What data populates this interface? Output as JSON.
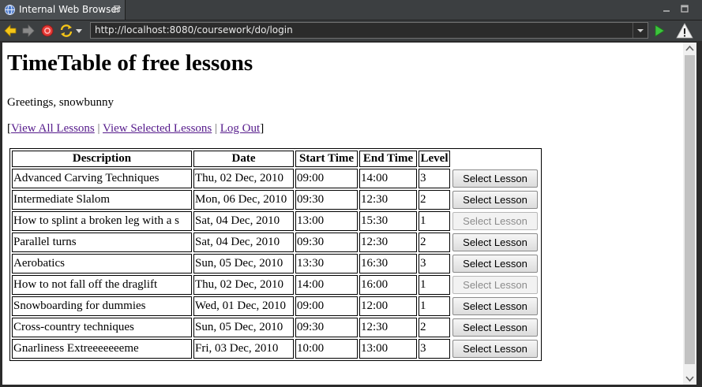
{
  "window": {
    "tab_title": "Internal Web Browser",
    "close_glyph": "⊠"
  },
  "toolbar": {
    "url": "http://localhost:8080/coursework/do/login",
    "icons": [
      "back-icon",
      "forward-icon",
      "stop-icon",
      "refresh-icon",
      "go-icon",
      "warning-icon"
    ]
  },
  "page": {
    "title": "TimeTable of free lessons",
    "greeting": "Greetings, snowbunny",
    "nav": {
      "open_bracket": "[",
      "close_bracket": "]",
      "separator": "|",
      "view_all": "View All Lessons",
      "view_selected": "View Selected Lessons",
      "logout": "Log Out"
    },
    "table": {
      "headers": [
        "Description",
        "Date",
        "Start Time",
        "End Time",
        "Level"
      ],
      "button_label": "Select Lesson",
      "rows": [
        {
          "desc": "Advanced Carving Techniques",
          "date": "Thu, 02 Dec, 2010",
          "start": "09:00",
          "end": "14:00",
          "level": "3",
          "enabled": true
        },
        {
          "desc": "Intermediate Slalom",
          "date": "Mon, 06 Dec, 2010",
          "start": "09:30",
          "end": "12:30",
          "level": "2",
          "enabled": true
        },
        {
          "desc": "How to splint a broken leg with a s",
          "date": "Sat, 04 Dec, 2010",
          "start": "13:00",
          "end": "15:30",
          "level": "1",
          "enabled": false
        },
        {
          "desc": "Parallel turns",
          "date": "Sat, 04 Dec, 2010",
          "start": "09:30",
          "end": "12:30",
          "level": "2",
          "enabled": true
        },
        {
          "desc": "Aerobatics",
          "date": "Sun, 05 Dec, 2010",
          "start": "13:30",
          "end": "16:30",
          "level": "3",
          "enabled": true
        },
        {
          "desc": "How to not fall off the draglift",
          "date": "Thu, 02 Dec, 2010",
          "start": "14:00",
          "end": "16:00",
          "level": "1",
          "enabled": false
        },
        {
          "desc": "Snowboarding for dummies",
          "date": "Wed, 01 Dec, 2010",
          "start": "09:00",
          "end": "12:00",
          "level": "1",
          "enabled": true
        },
        {
          "desc": "Cross-country techniques",
          "date": "Sun, 05 Dec, 2010",
          "start": "09:30",
          "end": "12:30",
          "level": "2",
          "enabled": true
        },
        {
          "desc": "Gnarliness Extreeeeeeeme",
          "date": "Fri, 03 Dec, 2010",
          "start": "10:00",
          "end": "13:00",
          "level": "3",
          "enabled": true
        }
      ]
    }
  },
  "colors": {
    "chrome_bg": "#3c3f41",
    "link_visited": "#551a8b",
    "back_arrow": "#f5c518",
    "stop": "#e53935",
    "refresh": "#f5c518",
    "go": "#3cc43c"
  }
}
